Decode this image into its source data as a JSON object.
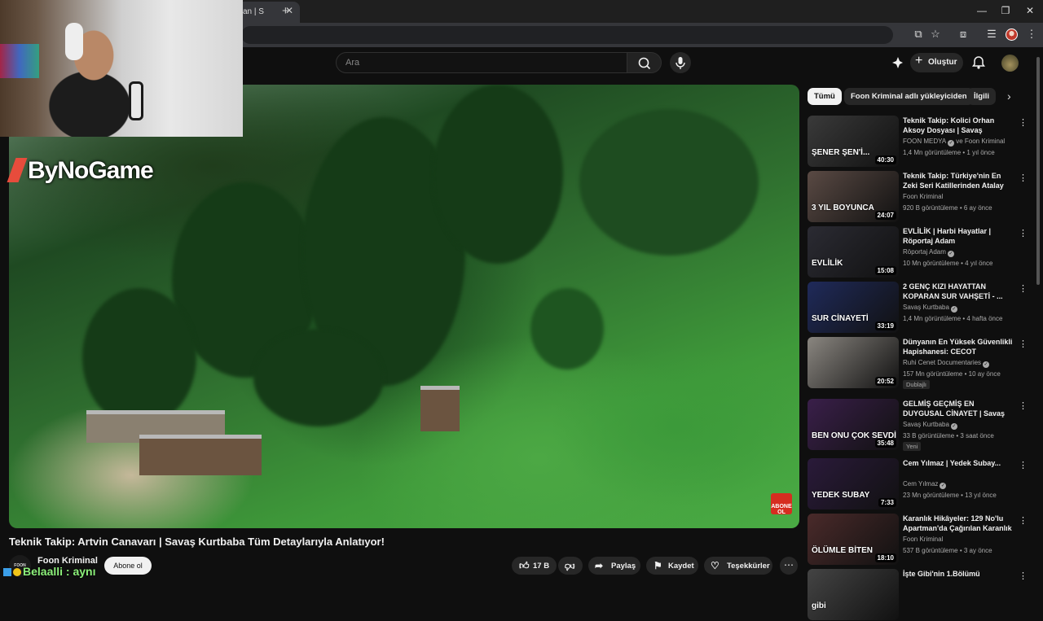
{
  "browser": {
    "tab_title": "an | S",
    "new_tab_symbol": "+",
    "window_controls": {
      "minimize": "—",
      "restore": "❐",
      "close": "✕"
    }
  },
  "masthead": {
    "search_placeholder": "Ara",
    "create_label": "Oluştur"
  },
  "player": {
    "watermark_text": "ByNoGame",
    "subscribe_badge": "ABONE OL"
  },
  "video": {
    "title": "Teknik Takip: Artvin Canavarı | Savaş Kurtbaba Tüm Detaylarıyla Anlatıyor!",
    "channel_name": "Foon Kriminal",
    "channel_avatar_text": "FOON",
    "subscribe_label": "Abone ol",
    "overlay_tag": "Belaalli : aynı",
    "like_count": "17 B",
    "share_label": "Paylaş",
    "save_label": "Kaydet",
    "thanks_label": "Teşekkürler"
  },
  "chips": [
    "Tümü",
    "Foon Kriminal adlı yükleyiciden",
    "İlgili"
  ],
  "recommendations": [
    {
      "title": "Teknik Takip: Kolici Orhan Aksoy Dosyası | Savaş Kurtba...",
      "channel": "FOON MEDYA",
      "channel_suffix": "ve Foon Kriminal",
      "verified": true,
      "meta": "1,4 Mn görüntüleme • 1 yıl önce",
      "duration": "40:30",
      "thumb_text": "ŞENER ŞEN'İ...",
      "thumb_color": "#3a3a3a",
      "badge": ""
    },
    {
      "title": "Teknik Takip: Türkiye'nin En Zeki Seri Katillerinden Atalay Filiz | ...",
      "channel": "Foon Kriminal",
      "channel_suffix": "",
      "verified": false,
      "meta": "920 B görüntüleme • 6 ay önce",
      "duration": "24:07",
      "thumb_text": "3 YIL BOYUNCA",
      "thumb_color": "#5a4a44",
      "badge": ""
    },
    {
      "title": "EVLİLİK | Harbi Hayatlar | Röportaj Adam",
      "channel": "Röportaj Adam",
      "channel_suffix": "",
      "verified": true,
      "meta": "10 Mn görüntüleme • 4 yıl önce",
      "duration": "15:08",
      "thumb_text": "EVLİLİK",
      "thumb_color": "#2b2b33",
      "badge": ""
    },
    {
      "title": "2 GENÇ KIZI HAYATTAN KOPARAN SUR VAHŞETİ - ...",
      "channel": "Savaş Kurtbaba",
      "channel_suffix": "",
      "verified": true,
      "meta": "1,4 Mn görüntüleme • 4 hafta önce",
      "duration": "33:19",
      "thumb_text": "SUR CİNAYETİ",
      "thumb_color": "#1f2a5a",
      "badge": ""
    },
    {
      "title": "Dünyanın En Yüksek Güvenlikli Hapishanesi: CECOT (Şeytanla...",
      "channel": "Ruhi Cenet Documentaries",
      "channel_suffix": "",
      "verified": true,
      "meta": "157 Mn görüntüleme • 10 ay önce",
      "duration": "20:52",
      "thumb_text": "",
      "thumb_color": "#8a8680",
      "badge": "Dublajlı"
    },
    {
      "title": "GELMİŞ GEÇMİŞ EN DUYGUSAL CİNAYET | Savaş Kurtbaba ile ...",
      "channel": "Savaş Kurtbaba",
      "channel_suffix": "",
      "verified": true,
      "meta": "33 B görüntüleme • 3 saat önce",
      "duration": "35:48",
      "thumb_text": "BEN ONU ÇOK SEVDİ",
      "thumb_color": "#3a1f4a",
      "badge": "Yeni"
    },
    {
      "title": "Cem Yılmaz | Yedek Subay...",
      "channel": "Cem Yılmaz",
      "channel_suffix": "",
      "verified": true,
      "meta": "23 Mn görüntüleme • 13 yıl önce",
      "duration": "7:33",
      "thumb_text": "YEDEK SUBAY",
      "thumb_color": "#2a1a3a",
      "badge": ""
    },
    {
      "title": "Karanlık Hikâyeler: 129 No'lu Apartman'da Çağırılan Karanlık",
      "channel": "Foon Kriminal",
      "channel_suffix": "",
      "verified": false,
      "meta": "537 B görüntüleme • 3 ay önce",
      "duration": "18:10",
      "thumb_text": "ÖLÜMLE BİTEN",
      "thumb_color": "#4a2a2a",
      "badge": ""
    },
    {
      "title": "İşte Gibi'nin 1.Bölümü",
      "channel": "",
      "channel_suffix": "",
      "verified": false,
      "meta": "",
      "duration": "",
      "thumb_text": "gibi",
      "thumb_color": "#444",
      "badge": ""
    }
  ],
  "colors": {
    "background": "#0f0f0f",
    "surface": "#272727",
    "text": "#f1f1f1",
    "muted": "#aaaaaa",
    "brand_red": "#d62d20"
  }
}
